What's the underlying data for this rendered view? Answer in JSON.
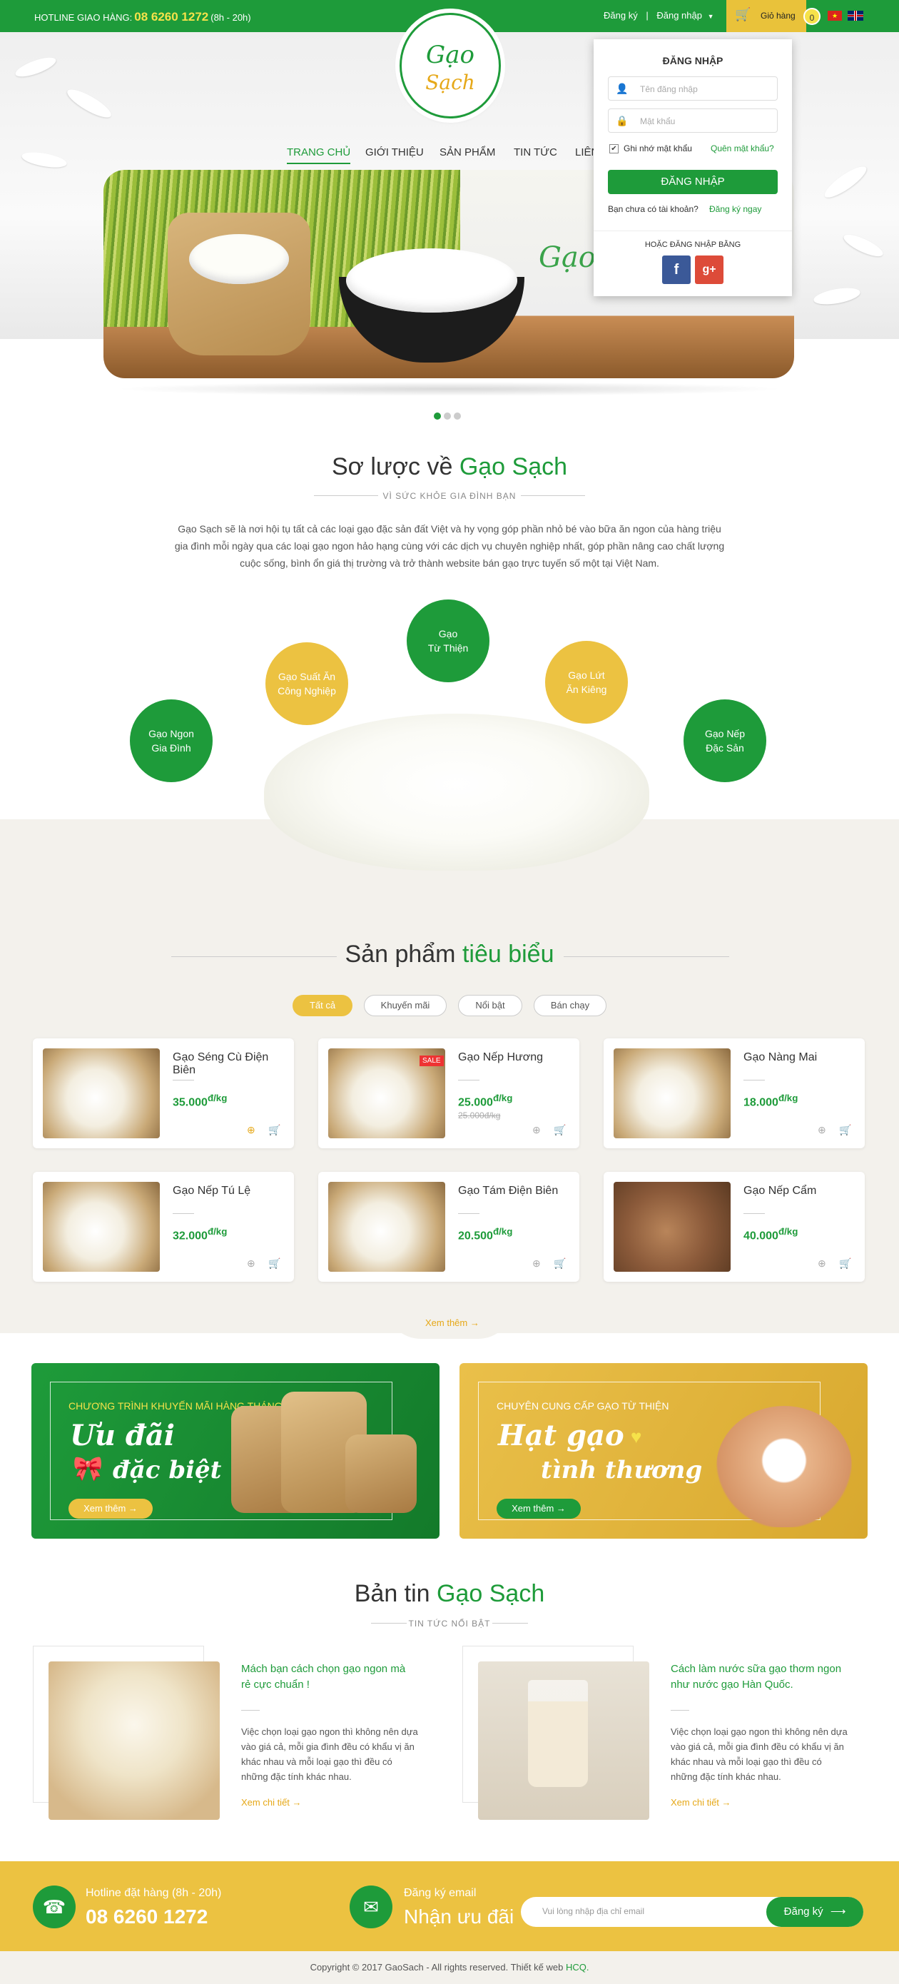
{
  "topbar": {
    "hotline_label": "HOTLINE GIAO HÀNG:",
    "hotline_number": "08 6260 1272",
    "hotline_hours": "(8h - 20h)",
    "register": "Đăng ký",
    "sep": "|",
    "login": "Đăng nhập",
    "cart": "Giỏ hàng",
    "cart_count": "0"
  },
  "logo": {
    "line1": "Gạo",
    "line2": "Sạch"
  },
  "nav": [
    "TRANG CHỦ",
    "GIỚI THIỆU",
    "SẢN PHẨM",
    "TIN TỨC",
    "LIÊN"
  ],
  "slider": {
    "text": "Gạo s"
  },
  "login": {
    "title": "ĐĂNG NHẬP",
    "username_placeholder": "Tên đăng nhập",
    "password_placeholder": "Mật khẩu",
    "remember": "Ghi nhớ mật khẩu",
    "forgot": "Quên mật khẩu?",
    "submit": "ĐĂNG NHẬP",
    "no_account": "Bạn chưa có tài khoản?",
    "register_now": "Đăng ký ngay",
    "or_login": "HOẶC ĐĂNG NHẬP BẰNG",
    "facebook": "f",
    "google": "g+"
  },
  "about": {
    "title_pre": "Sơ lược về",
    "title_hl": "Gạo Sạch",
    "subtitle": "VÌ SỨC KHỎE GIA ĐÌNH BẠN",
    "text": "Gạo Sạch sẽ là nơi hội tụ tất cả các loại gạo đặc sản đất Việt và hy vọng góp phần nhỏ bé vào bữa ăn ngon của hàng triệu gia đình mỗi ngày qua các loại gạo ngon hảo hạng cùng với các dịch vụ chuyên nghiệp nhất, góp phần nâng cao chất lượng cuộc sống, bình ổn giá thị trường và trở thành website bán gạo trực tuyến số một tại Việt Nam.",
    "circles": [
      {
        "l1": "Gạo Ngon",
        "l2": "Gia Đình"
      },
      {
        "l1": "Gạo Suất Ăn",
        "l2": "Công Nghiệp"
      },
      {
        "l1": "Gạo",
        "l2": "Từ Thiện"
      },
      {
        "l1": "Gạo Lứt",
        "l2": "Ăn Kiêng"
      },
      {
        "l1": "Gạo Nếp",
        "l2": "Đặc Sản"
      }
    ]
  },
  "products": {
    "title_pre": "Sản phẩm",
    "title_hl": "tiêu biểu",
    "filters": [
      "Tất cả",
      "Khuyến mãi",
      "Nổi bật",
      "Bán chạy"
    ],
    "items": [
      {
        "name": "Gạo Séng Cù Điện Biên",
        "price": "35.000",
        "unit": "đ/kg",
        "old": ""
      },
      {
        "name": "Gạo Nếp Hương",
        "price": "25.000",
        "unit": "đ/kg",
        "old": "25.000đ/kg",
        "sale": "SALE"
      },
      {
        "name": "Gạo Nàng Mai",
        "price": "18.000",
        "unit": "đ/kg",
        "old": ""
      },
      {
        "name": "Gạo Nếp Tú Lệ",
        "price": "32.000",
        "unit": "đ/kg",
        "old": ""
      },
      {
        "name": "Gạo Tám Điện Biên",
        "price": "20.500",
        "unit": "đ/kg",
        "old": ""
      },
      {
        "name": "Gạo Nếp Cẩm",
        "price": "40.000",
        "unit": "đ/kg",
        "old": ""
      }
    ],
    "more": "Xem thêm →"
  },
  "banners": [
    {
      "tag": "CHƯƠNG TRÌNH KHUYẾN MÃI HÀNG THÁNG",
      "big1": "Ưu đãi",
      "big2": "đặc biệt",
      "btn": "Xem thêm →"
    },
    {
      "tag": "CHUYÊN CUNG CẤP GẠO TỪ THIỆN",
      "big1": "Hạt gạo",
      "big2": "tình thương",
      "btn": "Xem thêm →"
    }
  ],
  "news": {
    "title_pre": "Bản tin",
    "title_hl": "Gạo Sạch",
    "subtitle": "TIN TỨC NỔI BẬT",
    "items": [
      {
        "title": "Mách bạn cách chọn gạo ngon mà rẻ cực chuẩn !",
        "desc": "Việc chọn loại gạo ngon thì không nên dựa vào giá cả, mỗi gia đình đều có khẩu vị ăn khác nhau và mỗi loại gạo thì đều có những đặc tính khác nhau.",
        "link": "Xem chi tiết →"
      },
      {
        "title": "Cách làm nước sữa gạo thơm ngon như nước gạo Hàn Quốc.",
        "desc": "Việc chọn loại gạo ngon thì không nên dựa vào giá cả, mỗi gia đình đều có khẩu vị ăn khác nhau và mỗi loại gạo thì đều có những đặc tính khác nhau.",
        "link": "Xem chi tiết →"
      }
    ]
  },
  "footer": {
    "hotline_label": "Hotline đặt hàng (8h - 20h)",
    "hotline": "08 6260 1272",
    "email_label": "Đăng ký email",
    "email_big": "Nhận ưu đãi",
    "email_placeholder": "Vui lòng nhập địa chỉ email",
    "subscribe": "Đăng ký",
    "copyright": "Copyright © 2017 GaoSach - All rights reserved. Thiết kế web",
    "copyright_link": "HCQ."
  }
}
